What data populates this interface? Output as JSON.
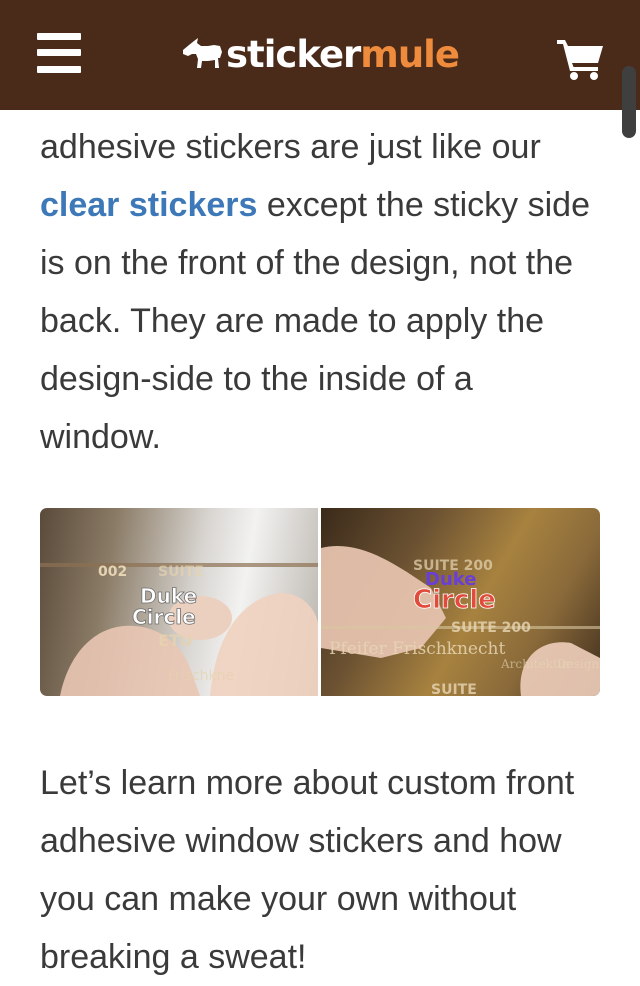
{
  "header": {
    "logo_part1": "sticker",
    "logo_part2": "mule",
    "colors": {
      "bar": "#4a2a18",
      "logo_accent": "#ef8b3c",
      "white": "#ffffff"
    },
    "icons": [
      "menu-icon",
      "mule-icon",
      "cart-icon"
    ]
  },
  "article": {
    "para1_before": "adhesive stickers are just like our ",
    "para1_link": "clear stickers",
    "para1_after": " except the sticky side is on the front of the design, not the back. They are made to apply the design-side to the inside of a window.",
    "para2": "Let’s learn more about custom front adhesive window stickers and how you can make your own without breaking a sweat!",
    "link_color": "#3d78b8",
    "text_color": "#3a3a3a"
  },
  "photos": {
    "left_texts": [
      "002",
      "SUITE",
      "Duke",
      "Circle",
      "ETU",
      "Frischkne"
    ],
    "right_texts": [
      "SUITE 200",
      "Duke",
      "Circle",
      "SUITE 200",
      "Pfeifer Frischknecht",
      "Architektur",
      "Design",
      "SUITE"
    ]
  }
}
